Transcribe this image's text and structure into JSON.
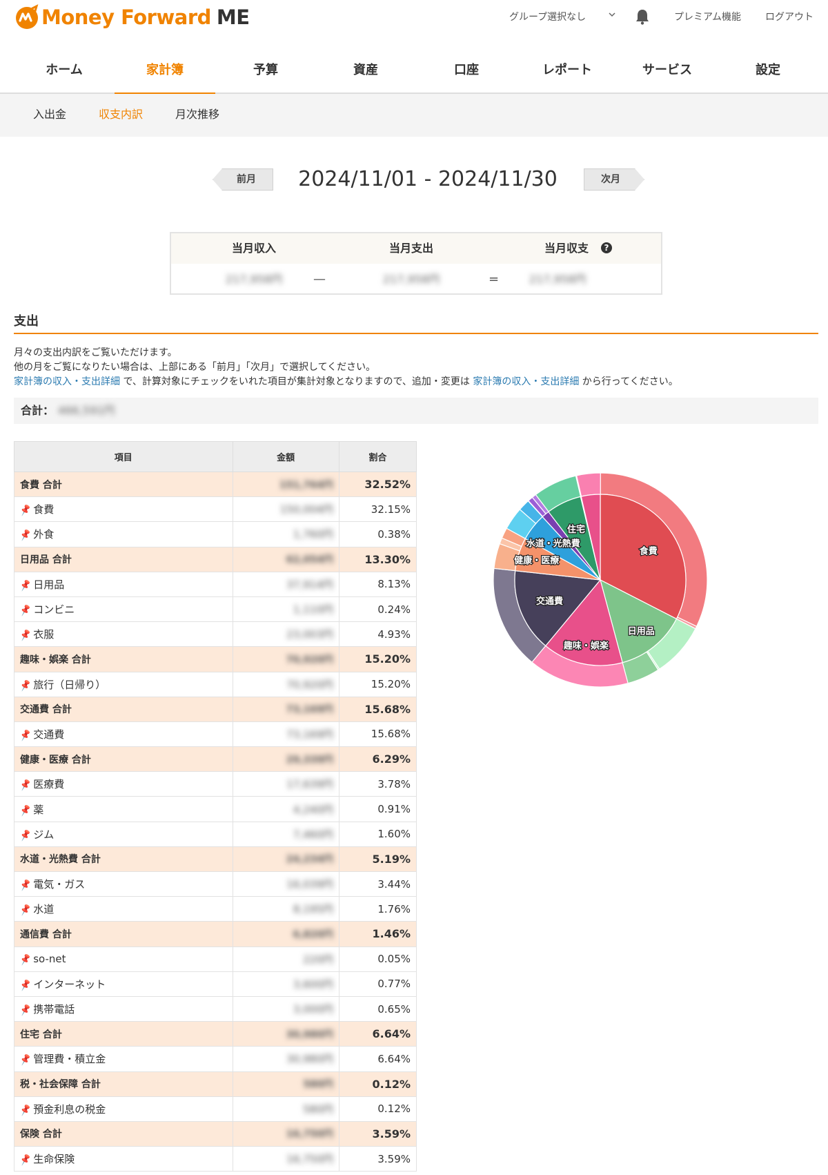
{
  "header": {
    "logo_text": "Money Forward",
    "logo_suffix": "ME",
    "group_select": "グループ選択なし",
    "premium": "プレミアム機能",
    "logout": "ログアウト",
    "icons": [
      "logo-icon",
      "chevron-down-icon",
      "bell-icon"
    ],
    "brand_color": "#f08300"
  },
  "nav": {
    "items": [
      "ホーム",
      "家計簿",
      "予算",
      "資産",
      "口座",
      "レポート",
      "サービス",
      "設定"
    ],
    "active": "家計簿"
  },
  "subnav": {
    "items": [
      "入出金",
      "収支内訳",
      "月次推移"
    ],
    "active": "収支内訳"
  },
  "date_nav": {
    "prev": "前月",
    "range": "2024/11/01 - 2024/11/30",
    "next": "次月"
  },
  "summary": {
    "income_label": "当月収入",
    "expense_label": "当月支出",
    "balance_label": "当月収支",
    "income_value": "217,958円",
    "expense_value": "217,958円",
    "balance_value": "217,958円",
    "minus": "—",
    "equals": "="
  },
  "expense": {
    "title": "支出",
    "desc1": "月々の支出内訳をご覧いただけます。",
    "desc2": "他の月をご覧になりたい場合は、上部にある「前月」「次月」で選択してください。",
    "desc3_link1": "家計簿の収入・支出詳細",
    "desc3_mid": " で、計算対象にチェックをいれた項目が集計対象となりますので、追加・変更は ",
    "desc3_link2": "家計簿の収入・支出詳細",
    "desc3_end": " から行ってください。",
    "total_label": "合計：",
    "total_value": "466,591円"
  },
  "table": {
    "headers": [
      "項目",
      "金額",
      "割合"
    ],
    "rows": [
      {
        "type": "group",
        "name": "食費 合計",
        "amount": "151,764円",
        "pct": "32.52%"
      },
      {
        "type": "item",
        "name": "食費",
        "amount": "150,004円",
        "pct": "32.15%"
      },
      {
        "type": "item",
        "name": "外食",
        "amount": "1,760円",
        "pct": "0.38%"
      },
      {
        "type": "group",
        "name": "日用品 合計",
        "amount": "62,054円",
        "pct": "13.30%"
      },
      {
        "type": "item",
        "name": "日用品",
        "amount": "37,914円",
        "pct": "8.13%"
      },
      {
        "type": "item",
        "name": "コンビニ",
        "amount": "1,110円",
        "pct": "0.24%"
      },
      {
        "type": "item",
        "name": "衣服",
        "amount": "23,003円",
        "pct": "4.93%"
      },
      {
        "type": "group",
        "name": "趣味・娯楽 合計",
        "amount": "70,920円",
        "pct": "15.20%"
      },
      {
        "type": "item",
        "name": "旅行（日帰り）",
        "amount": "70,920円",
        "pct": "15.20%"
      },
      {
        "type": "group",
        "name": "交通費 合計",
        "amount": "73,169円",
        "pct": "15.68%"
      },
      {
        "type": "item",
        "name": "交通費",
        "amount": "73,169円",
        "pct": "15.68%"
      },
      {
        "type": "group",
        "name": "健康・医療 合計",
        "amount": "29,339円",
        "pct": "6.29%"
      },
      {
        "type": "item",
        "name": "医療費",
        "amount": "17,639円",
        "pct": "3.78%"
      },
      {
        "type": "item",
        "name": "薬",
        "amount": "4,240円",
        "pct": "0.91%"
      },
      {
        "type": "item",
        "name": "ジム",
        "amount": "7,460円",
        "pct": "1.60%"
      },
      {
        "type": "group",
        "name": "水道・光熱費 合計",
        "amount": "24,234円",
        "pct": "5.19%"
      },
      {
        "type": "item",
        "name": "電気・ガス",
        "amount": "16,039円",
        "pct": "3.44%"
      },
      {
        "type": "item",
        "name": "水道",
        "amount": "8,195円",
        "pct": "1.76%"
      },
      {
        "type": "group",
        "name": "通信費 合計",
        "amount": "6,820円",
        "pct": "1.46%"
      },
      {
        "type": "item",
        "name": "so-net",
        "amount": "220円",
        "pct": "0.05%"
      },
      {
        "type": "item",
        "name": "インターネット",
        "amount": "3,600円",
        "pct": "0.77%"
      },
      {
        "type": "item",
        "name": "携帯電話",
        "amount": "3,000円",
        "pct": "0.65%"
      },
      {
        "type": "group",
        "name": "住宅 合計",
        "amount": "30,980円",
        "pct": "6.64%"
      },
      {
        "type": "item",
        "name": "管理費・積立金",
        "amount": "30,980円",
        "pct": "6.64%"
      },
      {
        "type": "group",
        "name": "税・社会保障 合計",
        "amount": "580円",
        "pct": "0.12%"
      },
      {
        "type": "item",
        "name": "預金利息の税金",
        "amount": "580円",
        "pct": "0.12%"
      },
      {
        "type": "group",
        "name": "保険 合計",
        "amount": "16,750円",
        "pct": "3.59%"
      },
      {
        "type": "item",
        "name": "生命保険",
        "amount": "16,750円",
        "pct": "3.59%"
      }
    ]
  },
  "chart_data": {
    "type": "pie",
    "inner": [
      {
        "name": "食費",
        "value": 32.52,
        "color": "#e04c52"
      },
      {
        "name": "日用品",
        "value": 13.3,
        "color": "#7ec48a"
      },
      {
        "name": "趣味・娯楽",
        "value": 15.2,
        "color": "#e8508a"
      },
      {
        "name": "交通費",
        "value": 15.68,
        "color": "#46405a"
      },
      {
        "name": "健康・医療",
        "value": 6.29,
        "color": "#f4926a"
      },
      {
        "name": "水道・光熱費",
        "value": 5.19,
        "color": "#2ea0dc"
      },
      {
        "name": "通信費",
        "value": 1.46,
        "color": "#7a3fb0"
      },
      {
        "name": "住宅",
        "value": 6.64,
        "color": "#2e9a68"
      },
      {
        "name": "税・社会保障",
        "value": 0.12,
        "color": "#b0b0b0"
      },
      {
        "name": "保険",
        "value": 3.59,
        "color": "#e8508a"
      }
    ],
    "outer": [
      {
        "value": 32.15,
        "color": "#f27b80"
      },
      {
        "value": 0.38,
        "color": "#f59a9e"
      },
      {
        "value": 8.13,
        "color": "#b4f0c4"
      },
      {
        "value": 0.24,
        "color": "#c6f4d2"
      },
      {
        "value": 4.93,
        "color": "#8ed09a"
      },
      {
        "value": 15.2,
        "color": "#fc86b4"
      },
      {
        "value": 15.68,
        "color": "#7e7890"
      },
      {
        "value": 3.78,
        "color": "#f8b08c"
      },
      {
        "value": 0.91,
        "color": "#fbc4a8"
      },
      {
        "value": 1.6,
        "color": "#f8a282"
      },
      {
        "value": 3.44,
        "color": "#5ed0f0"
      },
      {
        "value": 1.76,
        "color": "#46b4e8"
      },
      {
        "value": 0.05,
        "color": "#c9a2e8"
      },
      {
        "value": 0.77,
        "color": "#9c5ed6"
      },
      {
        "value": 0.65,
        "color": "#b27ee2"
      },
      {
        "value": 6.64,
        "color": "#66cfa0"
      },
      {
        "value": 0.12,
        "color": "#d0d0d0"
      },
      {
        "value": 3.59,
        "color": "#fa80b0"
      }
    ],
    "labels": [
      "食費",
      "日用品",
      "趣味・娯楽",
      "交通費",
      "健康・医療",
      "水道・光熱費",
      "住宅"
    ]
  }
}
